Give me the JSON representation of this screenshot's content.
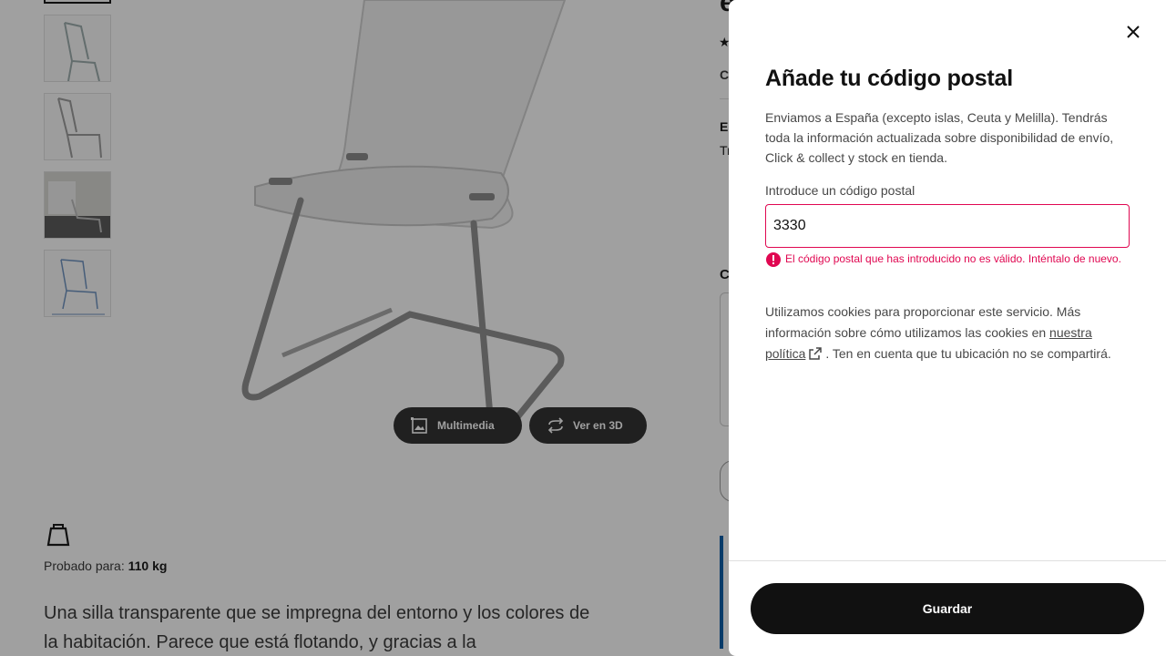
{
  "background": {
    "thumbnails": [
      {
        "name": "thumbnail-1"
      },
      {
        "name": "thumbnail-2"
      },
      {
        "name": "thumbnail-3"
      },
      {
        "name": "thumbnail-4"
      },
      {
        "name": "thumbnail-5"
      }
    ],
    "media_buttons": {
      "multimedia_label": "Multimedia",
      "view3d_label": "Ver en 3D"
    },
    "tested_label": "Probado para:",
    "tested_value": "110 kg",
    "description": "Una silla transparente que se impregna del entorno y los colores de la habitación. Parece que está flotando, y gracias a la",
    "right_column": {
      "title_fragment": "e",
      "star": "★",
      "co_fragment": "Co",
      "el_fragment": "El",
      "tr_fragment": "Tr",
      "c_fragment": "C"
    }
  },
  "modal": {
    "title": "Añade tu código postal",
    "intro": "Enviamos a España (excepto islas, Ceuta y Melilla). Tendrás toda la información actualizada sobre disponibilidad de envío, Click & collect y stock en tienda.",
    "field_label": "Introduce un código postal",
    "field_value": "3330",
    "error_message": "El código postal que has introducido no es válido. Inténtalo de nuevo.",
    "cookie_text_before": "Utilizamos cookies para proporcionar este servicio. Más información sobre cómo utilizamos las cookies en",
    "policy_link_label": "nuestra política",
    "cookie_text_after": ". Ten en cuenta que tu ubicación no se compartirá.",
    "save_label": "Guardar",
    "colors": {
      "error": "#e00751",
      "primary_button": "#111111",
      "overlay": "rgba(17,17,17,0.4)"
    },
    "icons": {
      "close": "close-icon",
      "error": "error-icon",
      "external_link": "external-link-icon"
    }
  }
}
